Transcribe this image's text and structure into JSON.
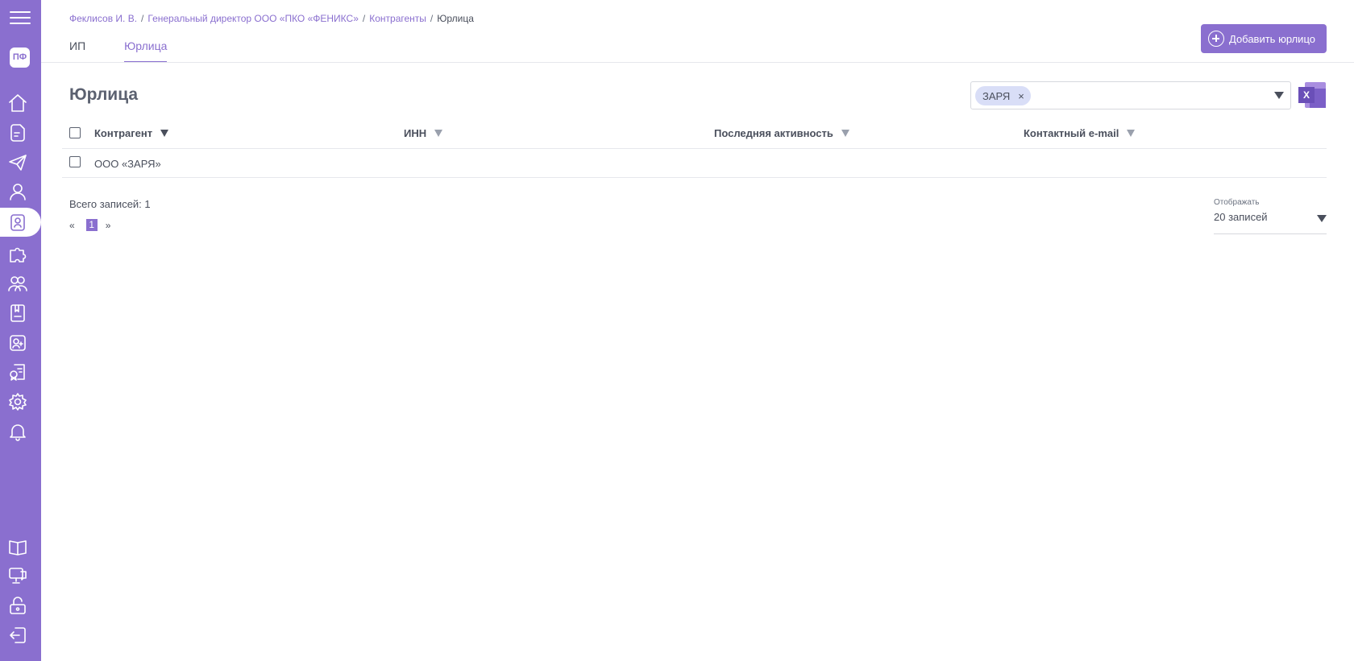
{
  "sidebar": {
    "logo_text": "ПФ",
    "active_index": 4,
    "items": [
      {
        "icon": "home-icon"
      },
      {
        "icon": "document-icon"
      },
      {
        "icon": "send-icon"
      },
      {
        "icon": "user-icon"
      },
      {
        "icon": "contractor-badge-icon"
      },
      {
        "icon": "puzzle-icon"
      },
      {
        "icon": "group-icon"
      },
      {
        "icon": "journal-icon"
      },
      {
        "icon": "user-add-icon"
      },
      {
        "icon": "certificate-icon"
      },
      {
        "icon": "gear-icon"
      },
      {
        "icon": "bell-icon"
      }
    ],
    "bottom_items": [
      {
        "icon": "book-icon"
      },
      {
        "icon": "monitor-chat-icon"
      },
      {
        "icon": "unlock-icon"
      },
      {
        "icon": "logout-icon"
      }
    ]
  },
  "breadcrumb": {
    "items": [
      "Феклисов И. В.",
      "Генеральный директор ООО «ПКО «ФЕНИКС»",
      "Контрагенты"
    ],
    "current": "Юрлица",
    "separator": "/"
  },
  "tabs": [
    {
      "label": "ИП",
      "active": false
    },
    {
      "label": "Юрлица",
      "active": true
    }
  ],
  "add_button_label": "Добавить юрлицо",
  "page_title": "Юрлица",
  "filter": {
    "chip": "ЗАРЯ",
    "chip_remove": "×"
  },
  "excel_label": "X",
  "table": {
    "columns": [
      "Контрагент",
      "ИНН",
      "Последняя активность",
      "Контактный e-mail"
    ],
    "rows": [
      {
        "name": "ООО «ЗАРЯ»"
      }
    ]
  },
  "footer": {
    "total": "Всего записей: 1",
    "prev": "«",
    "page": "1",
    "next": "»",
    "per_page_label": "Отображать",
    "per_page_value": "20 записей"
  },
  "colors": {
    "accent": "#8a6fcf",
    "chip": "#d9def7"
  }
}
